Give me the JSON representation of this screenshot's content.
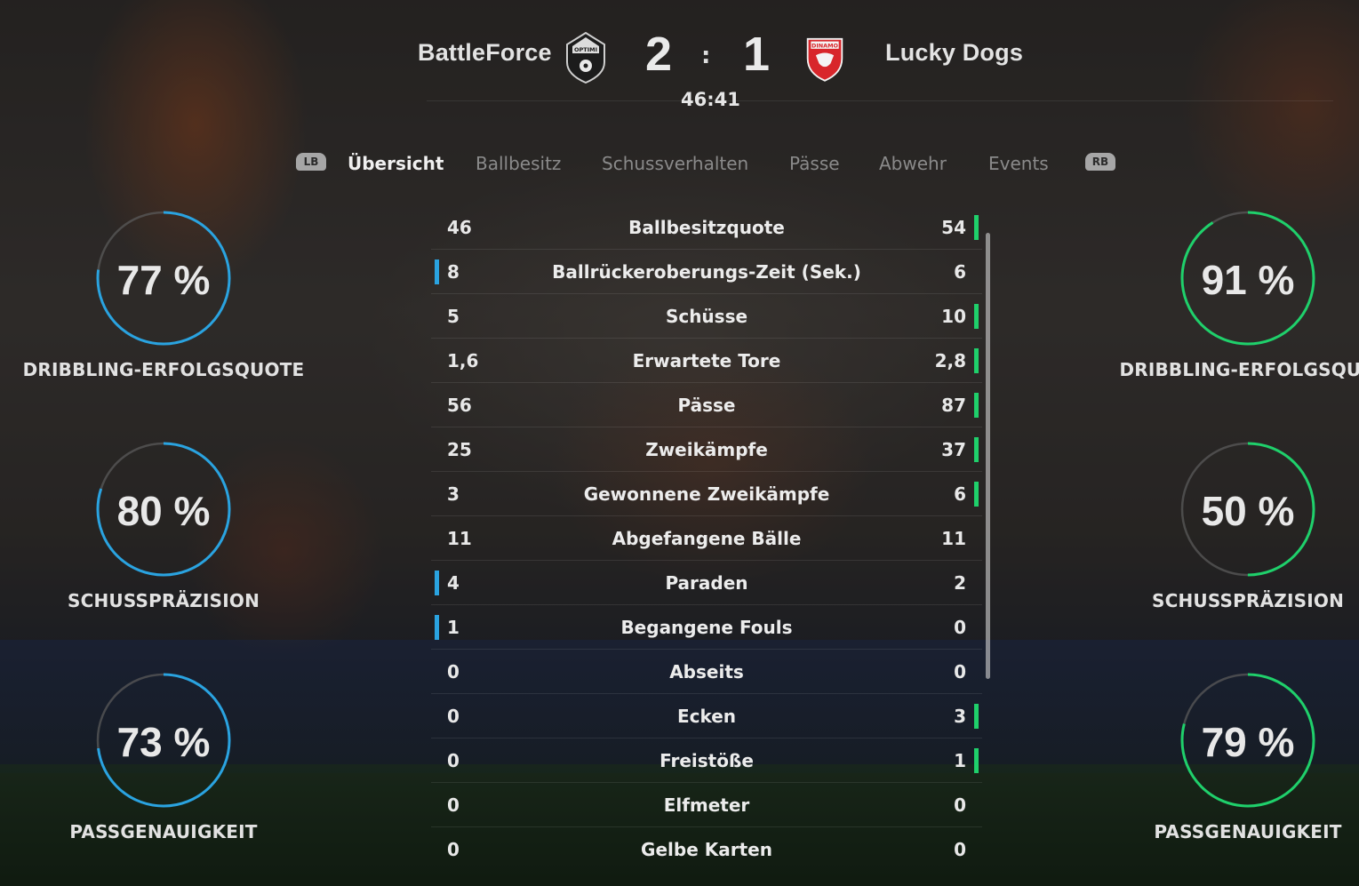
{
  "header": {
    "home_team": "BattleForce",
    "away_team": "Lucky Dogs",
    "home_score": "2",
    "away_score": "1",
    "separator": ":",
    "clock": "46:41"
  },
  "tabs": {
    "left_bumper": "LB",
    "right_bumper": "RB",
    "items": [
      "Übersicht",
      "Ballbesitz",
      "Schussverhalten",
      "Pässe",
      "Abwehr",
      "Events"
    ],
    "active": "Übersicht"
  },
  "stats": [
    {
      "label": "Ballbesitzquote",
      "home": "46",
      "away": "54",
      "lead": "away"
    },
    {
      "label": "Ballrückeroberungs-Zeit (Sek.)",
      "home": "8",
      "away": "6",
      "lead": "home"
    },
    {
      "label": "Schüsse",
      "home": "5",
      "away": "10",
      "lead": "away"
    },
    {
      "label": "Erwartete Tore",
      "home": "1,6",
      "away": "2,8",
      "lead": "away"
    },
    {
      "label": "Pässe",
      "home": "56",
      "away": "87",
      "lead": "away"
    },
    {
      "label": "Zweikämpfe",
      "home": "25",
      "away": "37",
      "lead": "away"
    },
    {
      "label": "Gewonnene Zweikämpfe",
      "home": "3",
      "away": "6",
      "lead": "away"
    },
    {
      "label": "Abgefangene Bälle",
      "home": "11",
      "away": "11",
      "lead": "none"
    },
    {
      "label": "Paraden",
      "home": "4",
      "away": "2",
      "lead": "home"
    },
    {
      "label": "Begangene Fouls",
      "home": "1",
      "away": "0",
      "lead": "home"
    },
    {
      "label": "Abseits",
      "home": "0",
      "away": "0",
      "lead": "none"
    },
    {
      "label": "Ecken",
      "home": "0",
      "away": "3",
      "lead": "away"
    },
    {
      "label": "Freistöße",
      "home": "0",
      "away": "1",
      "lead": "away"
    },
    {
      "label": "Elfmeter",
      "home": "0",
      "away": "0",
      "lead": "none"
    },
    {
      "label": "Gelbe Karten",
      "home": "0",
      "away": "0",
      "lead": "none"
    }
  ],
  "gauges": {
    "home": [
      {
        "value": "77 %",
        "percent": 77,
        "label": "DRIBBLING-ERFOLGSQUOTE"
      },
      {
        "value": "80 %",
        "percent": 80,
        "label": "SCHUSSPRÄZISION"
      },
      {
        "value": "73 %",
        "percent": 73,
        "label": "PASSGENAUIGKEIT"
      }
    ],
    "away": [
      {
        "value": "91 %",
        "percent": 91,
        "label": "DRIBBLING-ERFOLGSQUO"
      },
      {
        "value": "50 %",
        "percent": 50,
        "label": "SCHUSSPRÄZISION"
      },
      {
        "value": "79 %",
        "percent": 79,
        "label": "PASSGENAUIGKEIT"
      }
    ]
  },
  "colors": {
    "home_accent": "#2aa3e0",
    "away_accent": "#1fd06b",
    "away_crest": "#d8262b"
  },
  "crests": {
    "home_crest_text": "OPTIMI",
    "away_crest_text": "DINAMO"
  }
}
